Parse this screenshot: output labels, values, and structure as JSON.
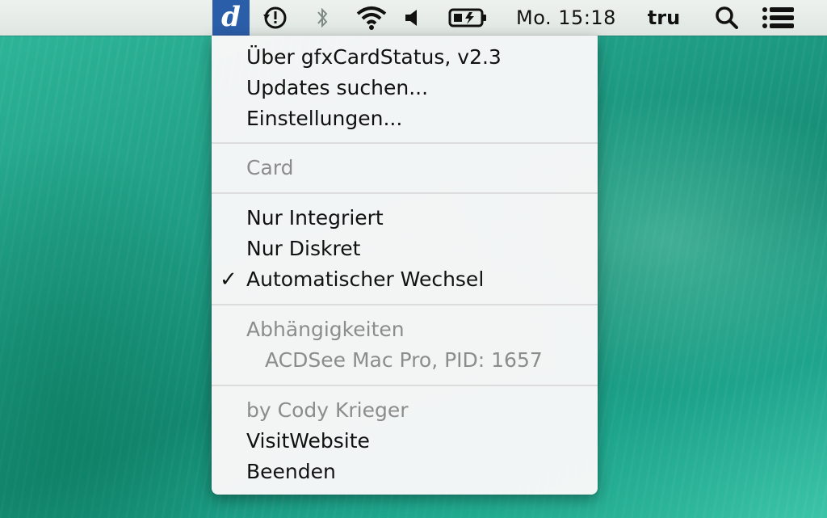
{
  "menubar": {
    "app_icon_letter": "d",
    "status_icons": [
      "time-machine-icon",
      "bluetooth-icon",
      "wifi-icon",
      "volume-icon",
      "battery-icon"
    ],
    "clock": "Mo. 15:18",
    "user": "tru",
    "extra_icons": [
      "spotlight-search-icon",
      "notification-center-icon"
    ]
  },
  "menu": {
    "about": "Über gfxCardStatus, v2.3",
    "updates": "Updates suchen...",
    "preferences": "Einstellungen...",
    "card_header": "Card",
    "integrated": "Nur Integriert",
    "discrete": "Nur Diskret",
    "automatic": "Automatischer Wechsel",
    "checkmark": "✓",
    "dependencies_header": "Abhängigkeiten",
    "dependency_item": "ACDSee Mac Pro, PID: 1657",
    "author": "by Cody Krieger",
    "website": "VisitWebsite",
    "quit": "Beenden"
  },
  "colors": {
    "app_icon_bg": "#2b5ea8",
    "menubar_bg": "#e6ece9",
    "menu_bg": "#f7f7f7",
    "disabled_text": "#8c8c8c",
    "wallpaper": "#1f9d85"
  }
}
